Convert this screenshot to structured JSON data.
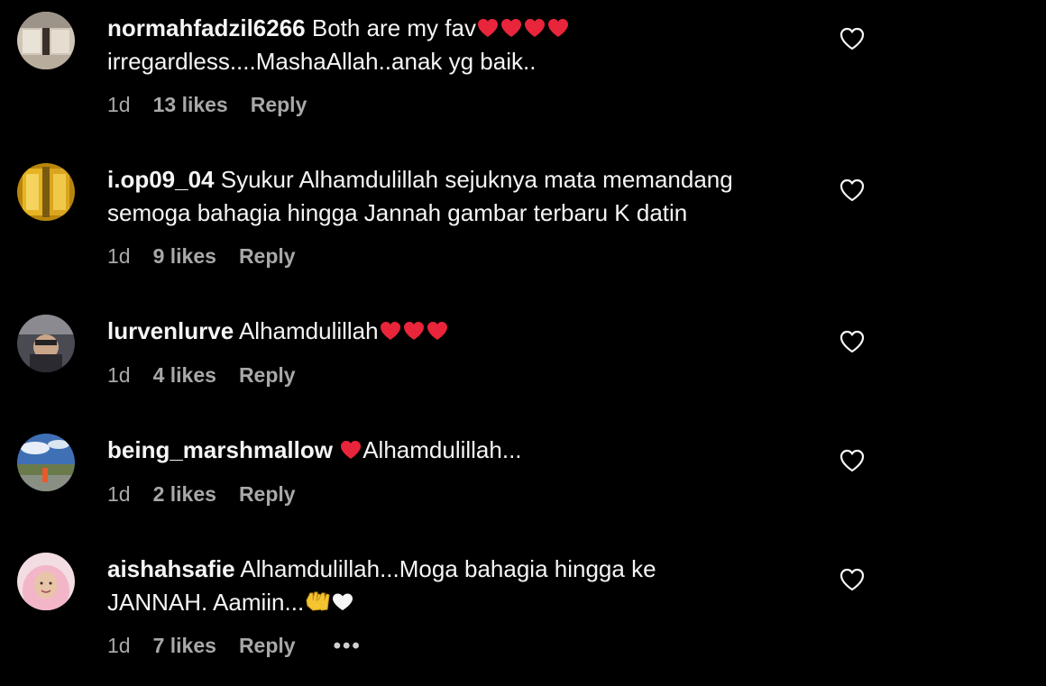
{
  "comments": [
    {
      "username": "normahfadzil6266",
      "text_before": " Both are my fav",
      "hearts_after": 4,
      "text_after": "",
      "line2": "irregardless....MashaAllah..anak yg baik..",
      "time": "1d",
      "likes": "13 likes",
      "reply": "Reply"
    },
    {
      "username": "i.op09_04",
      "text_before": " Syukur Alhamdulillah sejuknya mata memandang",
      "line2": "semoga bahagia hingga Jannah gambar terbaru K datin",
      "time": "1d",
      "likes": "9 likes",
      "reply": "Reply"
    },
    {
      "username": "lurvenlurve",
      "text_before": " Alhamdulillah",
      "hearts_after": 3,
      "time": "1d",
      "likes": "4 likes",
      "reply": "Reply"
    },
    {
      "username": "being_marshmallow",
      "text_before": " ",
      "text_after": "Alhamdulillah...",
      "time": "1d",
      "likes": "2 likes",
      "reply": "Reply"
    },
    {
      "username": "aishahsafie",
      "text_before": " Alhamdulillah...Moga bahagia hingga ke",
      "line2": "JANNAH. Aamiin...",
      "time": "1d",
      "likes": "7 likes",
      "reply": "Reply",
      "more": "•••"
    }
  ],
  "icons": {
    "like": "heart-outline-icon",
    "emoji_red_heart": "red-heart-emoji",
    "emoji_white_heart": "white-heart-emoji",
    "emoji_hands": "raising-hands-emoji"
  },
  "colors": {
    "background": "#000000",
    "text": "#f5f5f5",
    "meta": "#a8a8a8",
    "heart_red": "#e0245e"
  }
}
